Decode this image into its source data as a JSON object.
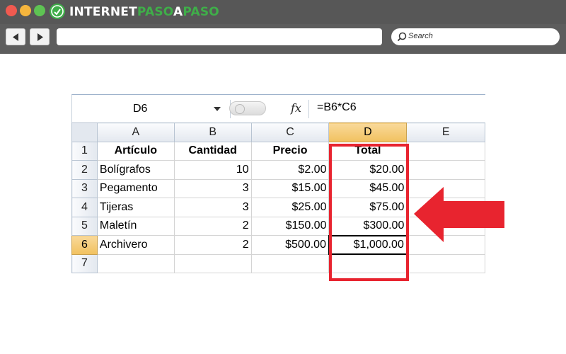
{
  "browser": {
    "brand_part1": "INTERNET",
    "brand_part2": "PASO",
    "brand_part3": "A",
    "brand_part4": "PASO",
    "search_placeholder": "Search",
    "colors": {
      "close": "#f15a50",
      "minimize": "#f5b53d",
      "maximize": "#5ec353",
      "brand_green": "#3fae49",
      "chrome": "#5d5d5d"
    }
  },
  "spreadsheet": {
    "name_box": "D6",
    "fx_label": "fx",
    "formula": "=B6*C6",
    "columns": [
      "A",
      "B",
      "C",
      "D",
      "E"
    ],
    "selected_column": "D",
    "row_numbers": [
      "1",
      "2",
      "3",
      "4",
      "5",
      "6",
      "7"
    ],
    "selected_row": "6",
    "headers": {
      "a": "Artículo",
      "b": "Cantidad",
      "c": "Precio",
      "d": "Total"
    },
    "rows": [
      {
        "a": "Bolígrafos",
        "b": "10",
        "c": "$2.00",
        "d": "$20.00"
      },
      {
        "a": "Pegamento",
        "b": "3",
        "c": "$15.00",
        "d": "$45.00"
      },
      {
        "a": "Tijeras",
        "b": "3",
        "c": "$25.00",
        "d": "$75.00"
      },
      {
        "a": "Maletín",
        "b": "2",
        "c": "$150.00",
        "d": "$300.00"
      },
      {
        "a": "Archivero",
        "b": "2",
        "c": "$500.00",
        "d": "$1,000.00"
      }
    ]
  },
  "annotation": {
    "highlight_color": "#e8242f",
    "arrow_color": "#e8242f"
  }
}
